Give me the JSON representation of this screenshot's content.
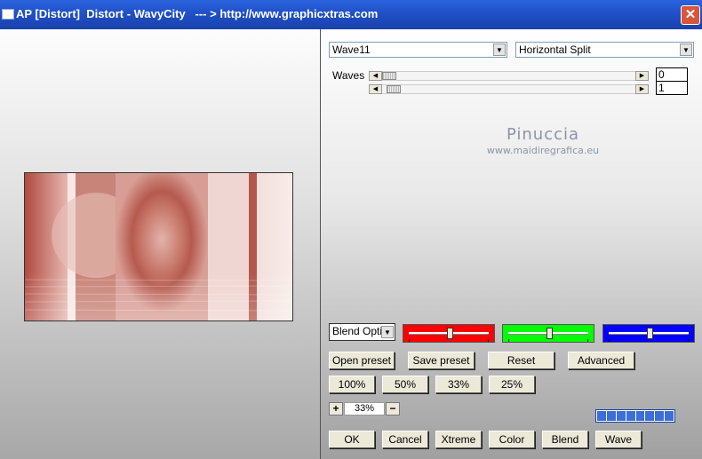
{
  "window": {
    "title": "AP [Distort]  Distort - WavyCity   --- > http://www.graphicxtras.com",
    "close_glyph": "✕"
  },
  "controls": {
    "effect_select": "Wave11",
    "mode_select": "Horizontal Split",
    "waves_label": "Waves",
    "slider1_value": "0",
    "slider2_value": "1",
    "slider1_fraction": 0.0,
    "slider2_fraction": 0.02
  },
  "watermark": {
    "name": "Pinuccia",
    "url": "www.maidiregrafica.eu"
  },
  "blend": {
    "select": "Blend Optio",
    "red_level": 0.5,
    "green_level": 0.5,
    "blue_level": 0.5,
    "colors": {
      "red": "#ff0000",
      "green": "#00ff00",
      "blue": "#0000ff"
    }
  },
  "buttons": {
    "open_preset": "Open preset",
    "save_preset": "Save preset",
    "reset": "Reset",
    "advanced": "Advanced",
    "zoom100": "100%",
    "zoom50": "50%",
    "zoom33": "33%",
    "zoom25": "25%",
    "ok": "OK",
    "cancel": "Cancel",
    "xtreme": "Xtreme",
    "color": "Color",
    "blend": "Blend",
    "wave": "Wave"
  },
  "zoom": {
    "plus": "+",
    "minus": "−",
    "value": "33%"
  },
  "progress_fraction": 1.0,
  "icons": [
    "app-icon",
    "close-icon",
    "dropdown-arrow-icon",
    "scroll-left-icon",
    "scroll-right-icon"
  ]
}
